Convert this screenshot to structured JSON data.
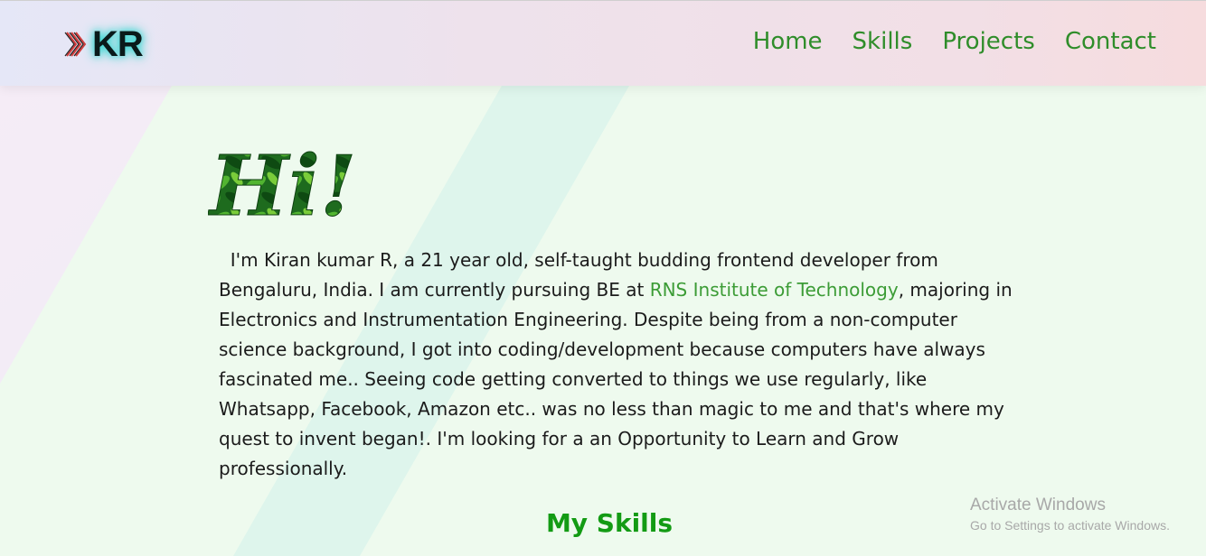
{
  "header": {
    "logo_text": "KR",
    "nav": {
      "home": "Home",
      "skills": "Skills",
      "projects": "Projects",
      "contact": "Contact"
    }
  },
  "main": {
    "greeting": "Hi!",
    "intro_part1": "I'm Kiran kumar R, a 21 year old, self-taught budding frontend developer from Bengaluru, India. I am currently pursuing BE at ",
    "intro_link": "RNS Institute of Technology",
    "intro_part2": ", majoring in Electronics and Instrumentation Engineering. Despite being from a non-computer science background, I got into coding/development because computers have always fascinated me.. Seeing code getting converted to things we use regularly, like Whatsapp, Facebook, Amazon etc.. was no less than magic to me and that's where my quest to invent began!. I'm looking for a an Opportunity to Learn and Grow professionally.",
    "skills_heading": "My Skills"
  },
  "watermark": {
    "title": "Activate Windows",
    "subtitle": "Go to Settings to activate Windows."
  },
  "colors": {
    "nav": "#2f8d2a",
    "link": "#3c9c36",
    "heading": "#139b14",
    "logo_glow": "#2fd6cf",
    "background": "#eefaee"
  }
}
